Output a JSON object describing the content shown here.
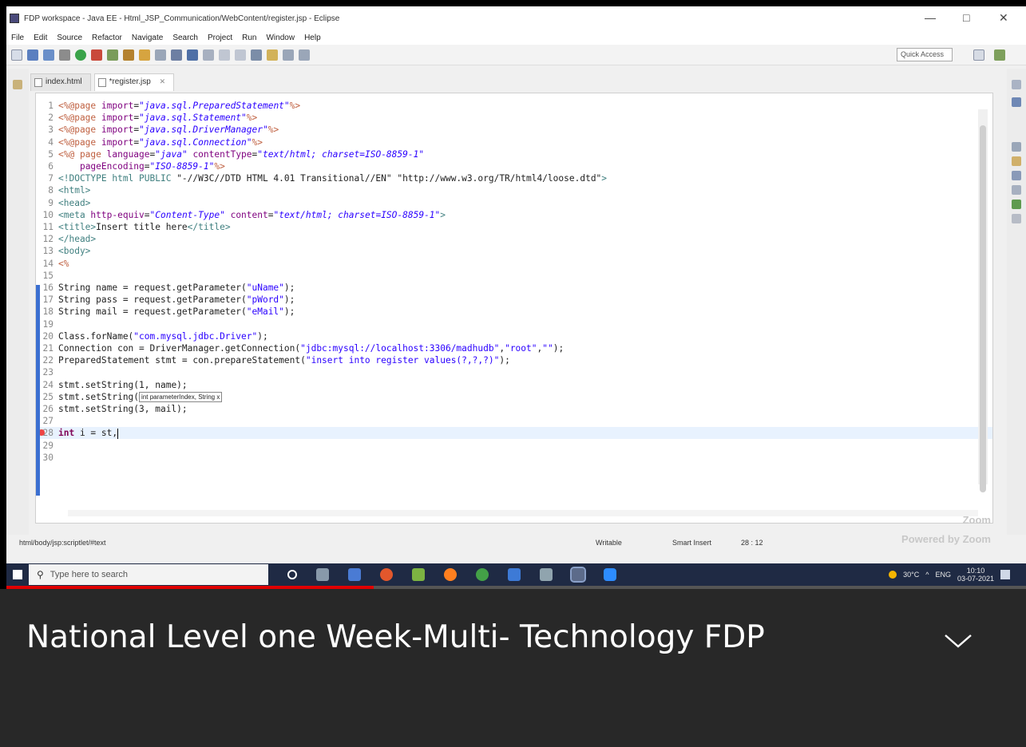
{
  "window": {
    "title": "FDP workspace - Java EE - Html_JSP_Communication/WebContent/register.jsp - Eclipse",
    "controls": [
      "—",
      "□",
      "✕"
    ]
  },
  "menu": [
    "File",
    "Edit",
    "Source",
    "Refactor",
    "Navigate",
    "Search",
    "Project",
    "Run",
    "Window",
    "Help"
  ],
  "toolbar": {
    "quick_access": "Quick Access"
  },
  "tabs": [
    {
      "label": "index.html",
      "active": false
    },
    {
      "label": "*register.jsp",
      "active": true,
      "close": "✕"
    }
  ],
  "code": {
    "lines": [
      {
        "n": "1",
        "parts": [
          [
            "dir",
            "<%@page "
          ],
          [
            "attr",
            "import"
          ],
          [
            "",
            "="
          ],
          [
            "stri",
            "\"java.sql.PreparedStatement\""
          ],
          [
            "dir",
            "%>"
          ]
        ]
      },
      {
        "n": "2",
        "parts": [
          [
            "dir",
            "<%@page "
          ],
          [
            "attr",
            "import"
          ],
          [
            "",
            "="
          ],
          [
            "stri",
            "\"java.sql.Statement\""
          ],
          [
            "dir",
            "%>"
          ]
        ]
      },
      {
        "n": "3",
        "parts": [
          [
            "dir",
            "<%@page "
          ],
          [
            "attr",
            "import"
          ],
          [
            "",
            "="
          ],
          [
            "stri",
            "\"java.sql.DriverManager\""
          ],
          [
            "dir",
            "%>"
          ]
        ]
      },
      {
        "n": "4",
        "parts": [
          [
            "dir",
            "<%@page "
          ],
          [
            "attr",
            "import"
          ],
          [
            "",
            "="
          ],
          [
            "stri",
            "\"java.sql.Connection\""
          ],
          [
            "dir",
            "%>"
          ]
        ]
      },
      {
        "n": "5",
        "parts": [
          [
            "dir",
            "<%@ page "
          ],
          [
            "attr",
            "language"
          ],
          [
            "",
            "="
          ],
          [
            "stri",
            "\"java\""
          ],
          [
            "",
            " "
          ],
          [
            "attr",
            "contentType"
          ],
          [
            "",
            "="
          ],
          [
            "stri",
            "\"text/html; charset=ISO-8859-1\""
          ]
        ]
      },
      {
        "n": "6",
        "parts": [
          [
            "",
            "    "
          ],
          [
            "attr",
            "pageEncoding"
          ],
          [
            "",
            "="
          ],
          [
            "stri",
            "\"ISO-8859-1\""
          ],
          [
            "dir",
            "%>"
          ]
        ]
      },
      {
        "n": "7",
        "parts": [
          [
            "tag",
            "<!DOCTYPE html PUBLIC "
          ],
          [
            "",
            "\"-//W3C//DTD HTML 4.01 Transitional//EN\" \"http://www.w3.org/TR/html4/loose.dtd\""
          ],
          [
            "tag",
            ">"
          ]
        ]
      },
      {
        "n": "8",
        "parts": [
          [
            "tag",
            "<html>"
          ]
        ]
      },
      {
        "n": "9",
        "parts": [
          [
            "tag",
            "<head>"
          ]
        ]
      },
      {
        "n": "10",
        "parts": [
          [
            "tag",
            "<meta "
          ],
          [
            "attr",
            "http-equiv"
          ],
          [
            "",
            "="
          ],
          [
            "stri",
            "\"Content-Type\""
          ],
          [
            "",
            " "
          ],
          [
            "attr",
            "content"
          ],
          [
            "",
            "="
          ],
          [
            "stri",
            "\"text/html; charset=ISO-8859-1\""
          ],
          [
            "tag",
            ">"
          ]
        ]
      },
      {
        "n": "11",
        "parts": [
          [
            "tag",
            "<title>"
          ],
          [
            "",
            "Insert title here"
          ],
          [
            "tag",
            "</title>"
          ]
        ]
      },
      {
        "n": "12",
        "parts": [
          [
            "tag",
            "</head>"
          ]
        ]
      },
      {
        "n": "13",
        "parts": [
          [
            "tag",
            "<body>"
          ]
        ]
      },
      {
        "n": "14",
        "parts": [
          [
            "dir",
            "<%"
          ]
        ]
      },
      {
        "n": "15",
        "parts": []
      },
      {
        "n": "16",
        "parts": [
          [
            "",
            "String name = request.getParameter("
          ],
          [
            "str",
            "\"uName\""
          ],
          [
            "",
            ");"
          ]
        ]
      },
      {
        "n": "17",
        "parts": [
          [
            "",
            "String pass = request.getParameter("
          ],
          [
            "str",
            "\"pWord\""
          ],
          [
            "",
            ");"
          ]
        ]
      },
      {
        "n": "18",
        "parts": [
          [
            "",
            "String mail = request.getParameter("
          ],
          [
            "str",
            "\"eMail\""
          ],
          [
            "",
            ");"
          ]
        ]
      },
      {
        "n": "19",
        "parts": []
      },
      {
        "n": "20",
        "parts": [
          [
            "",
            "Class.forName("
          ],
          [
            "str",
            "\"com.mysql.jdbc.Driver\""
          ],
          [
            "",
            ");"
          ]
        ]
      },
      {
        "n": "21",
        "parts": [
          [
            "",
            "Connection con = DriverManager.getConnection("
          ],
          [
            "str",
            "\"jdbc:mysql://localhost:3306/madhudb\""
          ],
          [
            "",
            ","
          ],
          [
            "str",
            "\"root\""
          ],
          [
            "",
            ","
          ],
          [
            "str",
            "\"\""
          ],
          [
            "",
            ");"
          ]
        ]
      },
      {
        "n": "22",
        "parts": [
          [
            "",
            "PreparedStatement stmt = con.prepareStatement("
          ],
          [
            "str",
            "\"insert into register values(?,?,?)\""
          ],
          [
            "",
            ");"
          ]
        ]
      },
      {
        "n": "23",
        "parts": []
      },
      {
        "n": "24",
        "parts": [
          [
            "",
            "stmt.setString(1, name);"
          ]
        ]
      },
      {
        "n": "25",
        "parts": [
          [
            "",
            "stmt.setString("
          ],
          [
            "tip",
            "int parameterIndex, String x"
          ]
        ]
      },
      {
        "n": "26",
        "parts": [
          [
            "",
            "stmt.setString(3, mail);"
          ]
        ]
      },
      {
        "n": "27",
        "parts": []
      },
      {
        "n": "28",
        "parts": [
          [
            "kw",
            "int"
          ],
          [
            "",
            " i = st,"
          ],
          [
            "cursor",
            ""
          ]
        ]
      },
      {
        "n": "29",
        "parts": []
      },
      {
        "n": "30",
        "parts": []
      }
    ],
    "current_line": "28",
    "error_line": "28"
  },
  "statusbar": {
    "path": "html/body/jsp:scriptlet/#text",
    "writable": "Writable",
    "insert_mode": "Smart Insert",
    "position": "28 : 12",
    "watermark_top": "Zoom",
    "watermark_bottom": "Powered by Zoom"
  },
  "taskbar": {
    "search_placeholder": "Type here to search",
    "weather": "30°C",
    "language": "ENG",
    "time": "10:10",
    "date": "03-07-2021"
  },
  "video": {
    "progress_fraction": 0.36,
    "title": "National Level one Week-Multi- Technology FDP"
  },
  "colors": {
    "accent_blue": "#3b6fd1",
    "progress_red": "#e00000",
    "panel_bg": "#282828"
  }
}
